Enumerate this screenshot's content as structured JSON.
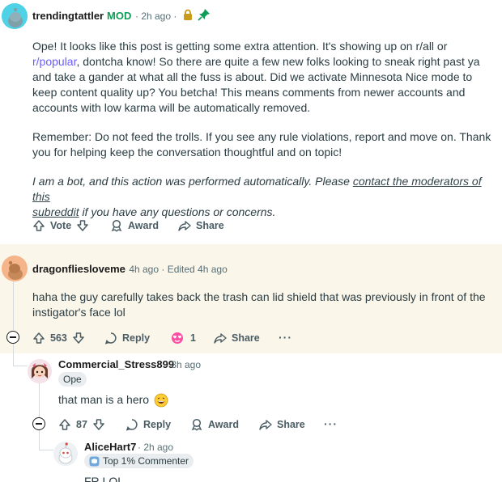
{
  "comment1": {
    "username": "trendingtattler",
    "mod_badge": "MOD",
    "time": "· 2h ago ·",
    "lock_icon": "lock-icon",
    "pin_icon": "pin-icon",
    "para1_a": "Ope! It looks like this post is getting some extra attention. It's showing up on r/all or",
    "para1_link": "r/popular",
    "para1_b": ", dontcha know! So there are quite a few new folks looking to sneak right past ya",
    "para1_c": "and take a gander at what all the fuss is about. Did we activate Minnesota Nice mode to",
    "para1_d": "keep content quality up? You betcha! This means comments from newer accounts and",
    "para1_e": "accounts with low karma will be automatically removed.",
    "para2_a": "Remember: Do not feed the trolls. If you see any rule violations, report and move on. Thank",
    "para2_b": "you for helping keep the conversation thoughtful and on topic!",
    "para3_a": "I am a bot, and this action was performed automatically. Please",
    "para3_link1": "contact the moderators of this",
    "para3_link2": "subreddit",
    "para3_b": "if you have any questions or concerns.",
    "vote_label": "Vote",
    "award_label": "Award",
    "share_label": "Share"
  },
  "comment2": {
    "username": "dragonfliesloveme",
    "time": "· 4h ago · Edited 4h ago",
    "body_a": "haha the guy carefully takes back the trash can lid shield that was previously in front of the",
    "body_b": "instigator's face lol",
    "votes": "563",
    "reply_label": "Reply",
    "award_count": "1",
    "share_label": "Share",
    "more": "···"
  },
  "comment3": {
    "username": "Commercial_Stress899",
    "time": "· 3h ago",
    "flair": "Ope",
    "body": "that man is a hero",
    "votes": "87",
    "reply_label": "Reply",
    "award_label": "Award",
    "share_label": "Share",
    "more": "···"
  },
  "comment4": {
    "username": "AliceHart7",
    "time": "· 2h ago",
    "flair": "Top 1% Commenter",
    "body": "FR LOL"
  },
  "colors": {
    "mod_green": "#0f9d58",
    "link_purple": "#6a5cff",
    "highlight_bg": "#fbf6ea"
  }
}
